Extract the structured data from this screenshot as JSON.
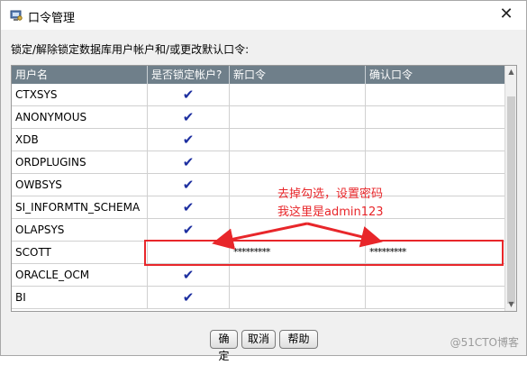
{
  "window": {
    "title": "口令管理",
    "close_glyph": "✕"
  },
  "instruction": "锁定/解除锁定数据库用户帐户和/或更改默认口令:",
  "table": {
    "headers": [
      "用户名",
      "是否锁定帐户?",
      "新口令",
      "确认口令"
    ],
    "rows": [
      {
        "user": "CTXSYS",
        "locked": "✔",
        "new_pw": "",
        "confirm_pw": ""
      },
      {
        "user": "ANONYMOUS",
        "locked": "✔",
        "new_pw": "",
        "confirm_pw": ""
      },
      {
        "user": "XDB",
        "locked": "✔",
        "new_pw": "",
        "confirm_pw": ""
      },
      {
        "user": "ORDPLUGINS",
        "locked": "✔",
        "new_pw": "",
        "confirm_pw": ""
      },
      {
        "user": "OWBSYS",
        "locked": "✔",
        "new_pw": "",
        "confirm_pw": ""
      },
      {
        "user": "SI_INFORMTN_SCHEMA",
        "locked": "✔",
        "new_pw": "",
        "confirm_pw": ""
      },
      {
        "user": "OLAPSYS",
        "locked": "✔",
        "new_pw": "",
        "confirm_pw": ""
      },
      {
        "user": "SCOTT",
        "locked": "",
        "new_pw": "*********",
        "confirm_pw": "*********"
      },
      {
        "user": "ORACLE_OCM",
        "locked": "✔",
        "new_pw": "",
        "confirm_pw": ""
      },
      {
        "user": "BI",
        "locked": "✔",
        "new_pw": "",
        "confirm_pw": ""
      }
    ]
  },
  "annotation": {
    "line1": "去掉勾选，设置密码",
    "line2": "我这里是admin123"
  },
  "buttons": {
    "ok": "确定",
    "cancel": "取消",
    "help": "帮助"
  },
  "watermark": "@51CTO博客",
  "colors": {
    "header_bg": "#6f7f8a",
    "check": "#1d2fa0",
    "annotation": "#e8262a"
  },
  "icons": {
    "app": "key-computer-icon",
    "check": "checkmark-icon"
  }
}
